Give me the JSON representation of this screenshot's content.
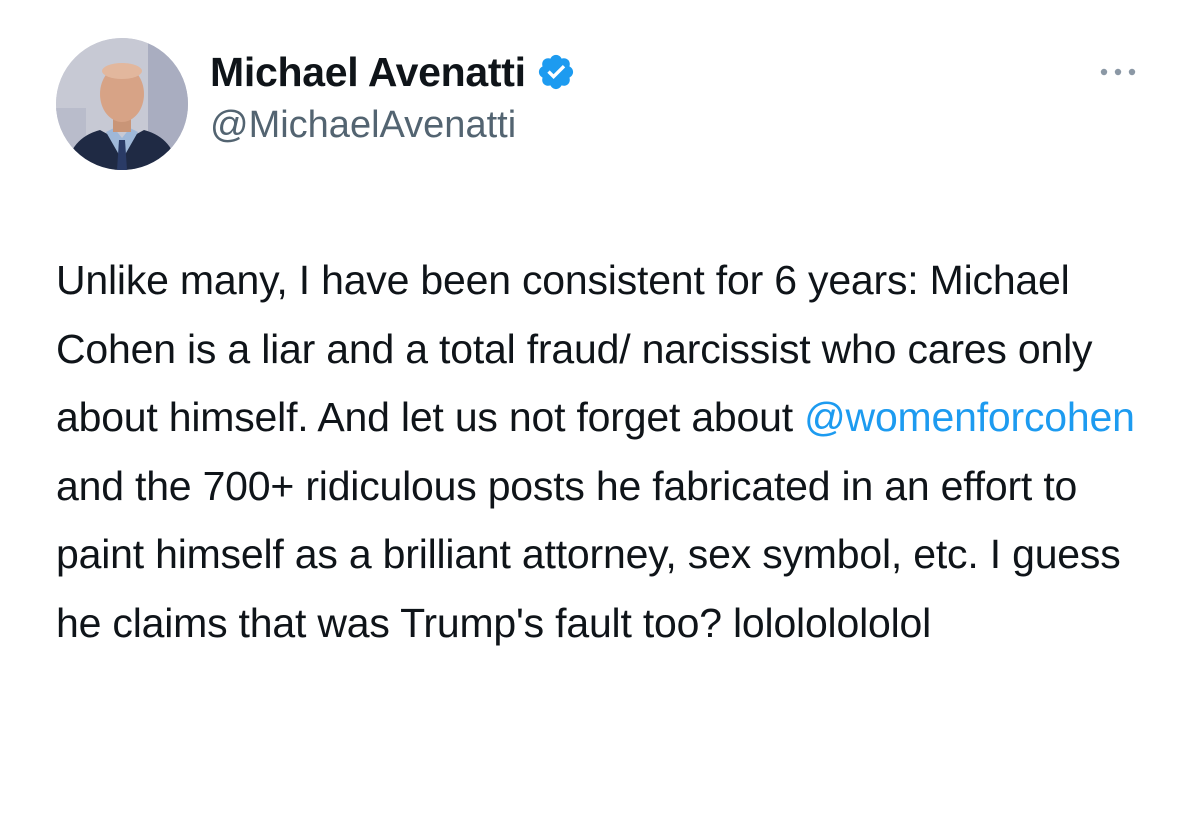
{
  "tweet": {
    "author": {
      "display_name": "Michael Avenatti",
      "handle": "@MichaelAvenatti",
      "verified": true,
      "avatar_icon": "profile-photo"
    },
    "more_icon": "more-horizontal-icon",
    "text": {
      "part1": "Unlike many, I have been consistent for 6 years: Michael Cohen is a liar and a total fraud/ narcissist who cares only about himself. And let us not forget about ",
      "mention": "@womenforcohen",
      "part2": " and the 700+ ridiculous posts he fabricated in an effort to paint himself as a brilliant attorney, sex symbol, etc. I guess he claims that was Trump's fault too? lolololololol"
    },
    "colors": {
      "link": "#1d9bf0",
      "verified_badge": "#1d9bf0",
      "handle": "#536471",
      "text": "#0f1419"
    }
  }
}
